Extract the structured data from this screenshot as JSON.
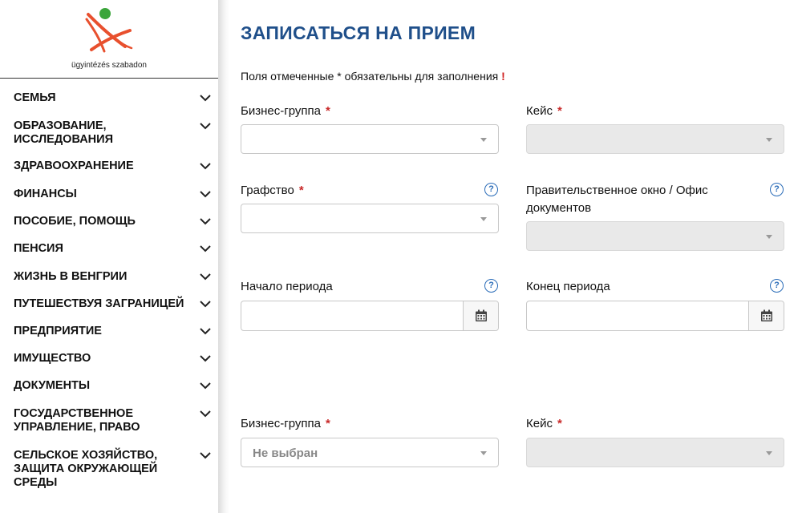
{
  "logo": {
    "caption": "ügyintézés szabadon",
    "accent_color": "#e8502e",
    "dot_color": "#3aa53a"
  },
  "sidebar": {
    "items": [
      {
        "label": "СЕМЬЯ"
      },
      {
        "label": "ОБРАЗОВАНИЕ, ИССЛЕДОВАНИЯ"
      },
      {
        "label": "ЗДРАВООХРАНЕНИЕ"
      },
      {
        "label": "ФИНАНСЫ"
      },
      {
        "label": "ПОСОБИЕ, ПОМОЩЬ"
      },
      {
        "label": "ПЕНСИЯ"
      },
      {
        "label": "ЖИЗНЬ В ВЕНГРИИ"
      },
      {
        "label": "ПУТЕШЕСТВУЯ ЗАГРАНИЦЕЙ"
      },
      {
        "label": "ПРЕДПРИЯТИЕ"
      },
      {
        "label": "ИМУЩЕСТВО"
      },
      {
        "label": "ДОКУМЕНТЫ"
      },
      {
        "label": "ГОСУДАРСТВЕННОЕ УПРАВЛЕНИЕ, ПРАВО"
      },
      {
        "label": "СЕЛЬСКОЕ ХОЗЯЙСТВО, ЗАЩИТА ОКРУЖАЮЩЕЙ СРЕДЫ"
      }
    ]
  },
  "main": {
    "title": "ЗАПИСАТЬСЯ НА ПРИЕМ",
    "required_note": "Поля отмеченные * обязательны для заполнения",
    "required_mark": "!",
    "star": "*",
    "help_glyph": "?",
    "form": {
      "business_group_label": "Бизнес-группа",
      "case_label": "Кейс",
      "county_label": "Графство",
      "office_label": "Правительственное окно / Офис документов",
      "period_start_label": "Начало периода",
      "period_end_label": "Конец периода",
      "business_group_2_label": "Бизнес-группа",
      "business_group_2_value": "Не выбран",
      "case_2_label": "Кейс"
    }
  },
  "colors": {
    "title": "#1f4f8a",
    "required": "#c82828",
    "help": "#2a6cb8"
  }
}
